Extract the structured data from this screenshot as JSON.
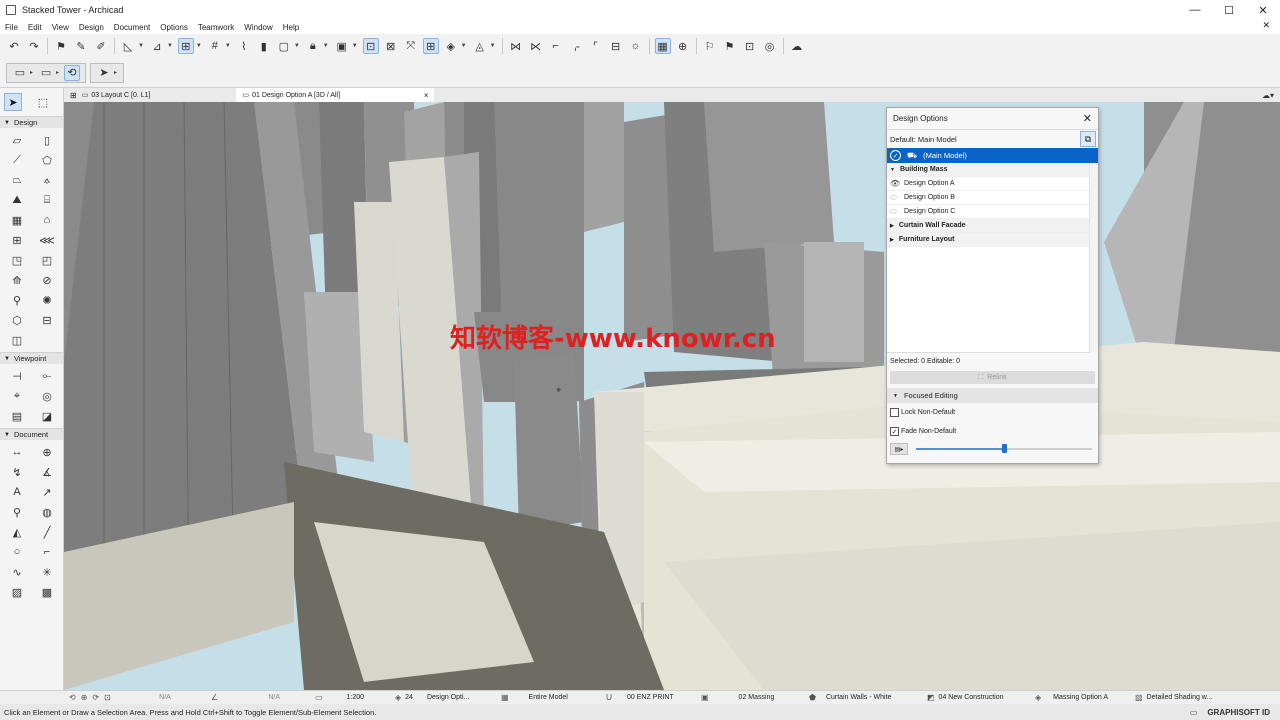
{
  "window": {
    "title": "Stacked Tower - Archicad",
    "min": "—",
    "max": "☐",
    "close": "✕"
  },
  "menu": [
    "File",
    "Edit",
    "View",
    "Design",
    "Document",
    "Options",
    "Teamwork",
    "Window",
    "Help"
  ],
  "menu_close": "✕",
  "toolbar1_icons": [
    "undo-icon",
    "redo-icon",
    "pick-up-icon",
    "inject-icon",
    "eyedropper-icon",
    "arrow-tool-icon",
    "elevation-icon",
    "gravity-icon",
    "grid-icon",
    "trace-icon",
    "pencil-icon",
    "box-icon",
    "lock-icon",
    "suspend-groups-icon",
    "layout-icon",
    "fit-icon",
    "rotate-icon",
    "explode-icon",
    "trim-icon",
    "split-icon",
    "adjust-icon",
    "fillet-icon",
    "offset-icon",
    "magic-wand-icon",
    "renovation-icon",
    "design-options-icon",
    "flag-icon",
    "marker-icon",
    "sun-icon",
    "globe-icon"
  ],
  "tabs": {
    "tab1": "03 Layout C [0. L1]",
    "tab2": "01 Design Option A [3D / All]",
    "tab2_close": "×",
    "right_icon": "☁▾"
  },
  "toolbox": {
    "sections": {
      "design": "Design",
      "viewpoint": "Viewpoint",
      "document": "Document"
    }
  },
  "design_options": {
    "title": "Design Options",
    "close": "✕",
    "default_label": "Default: Main Model",
    "main_model": "(Main Model)",
    "groups": [
      {
        "name": "Building Mass",
        "expanded": true,
        "options": [
          {
            "name": "Design Option A",
            "visible": true
          },
          {
            "name": "Design Option B",
            "visible": false
          },
          {
            "name": "Design Option C",
            "visible": false
          }
        ]
      },
      {
        "name": "Curtain Wall Facade",
        "expanded": false,
        "options": []
      },
      {
        "name": "Furniture Layout",
        "expanded": false,
        "options": []
      }
    ],
    "selected_info": "Selected: 0 Editable: 0",
    "relink": "Relink",
    "focused_editing": "Focused Editing",
    "lock_non_default": "Lock Non-Default",
    "lock_checked": false,
    "fade_non_default": "Fade Non-Default",
    "fade_checked": true,
    "fade_level": 0.5
  },
  "watermark": "知软博客-www.knowr.cn",
  "statusbar": {
    "na1": "N/A",
    "na2": "N/A",
    "scale": "1:200",
    "layer_num": "24",
    "layer": "Design Opti...",
    "model": "Entire Model",
    "pen": "00 ENZ PRINT",
    "mvo": "02 Massing",
    "graphic": "Curtain Walls - White",
    "renovation": "04 New Construction",
    "option": "Massing Option A",
    "shading": "Detailed Shading w..."
  },
  "hint": "Click an Element or Draw a Selection Area. Press and Hold Ctrl+Shift to Toggle Element/Sub-Element Selection.",
  "graphisoft": "GRAPHISOFT ID"
}
